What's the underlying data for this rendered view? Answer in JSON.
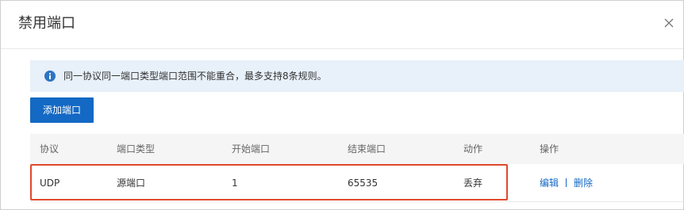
{
  "dialog": {
    "title": "禁用端口",
    "close_icon": "close-icon"
  },
  "notice": {
    "icon": "info-icon",
    "text": "同一协议同一端口类型端口范围不能重合，最多支持8条规则。",
    "background": "#e8f0f9"
  },
  "toolbar": {
    "add_label": "添加端口"
  },
  "table": {
    "headers": {
      "protocol": "协议",
      "port_type": "端口类型",
      "start_port": "开始端口",
      "end_port": "结束端口",
      "action": "动作",
      "operation": "操作"
    },
    "rows": [
      {
        "protocol": "UDP",
        "port_type": "源端口",
        "start_port": "1",
        "end_port": "65535",
        "action": "丢弃",
        "edit_label": "编辑",
        "delete_label": "删除"
      }
    ]
  },
  "colors": {
    "primary": "#1469c4",
    "highlight": "#e0492c"
  }
}
